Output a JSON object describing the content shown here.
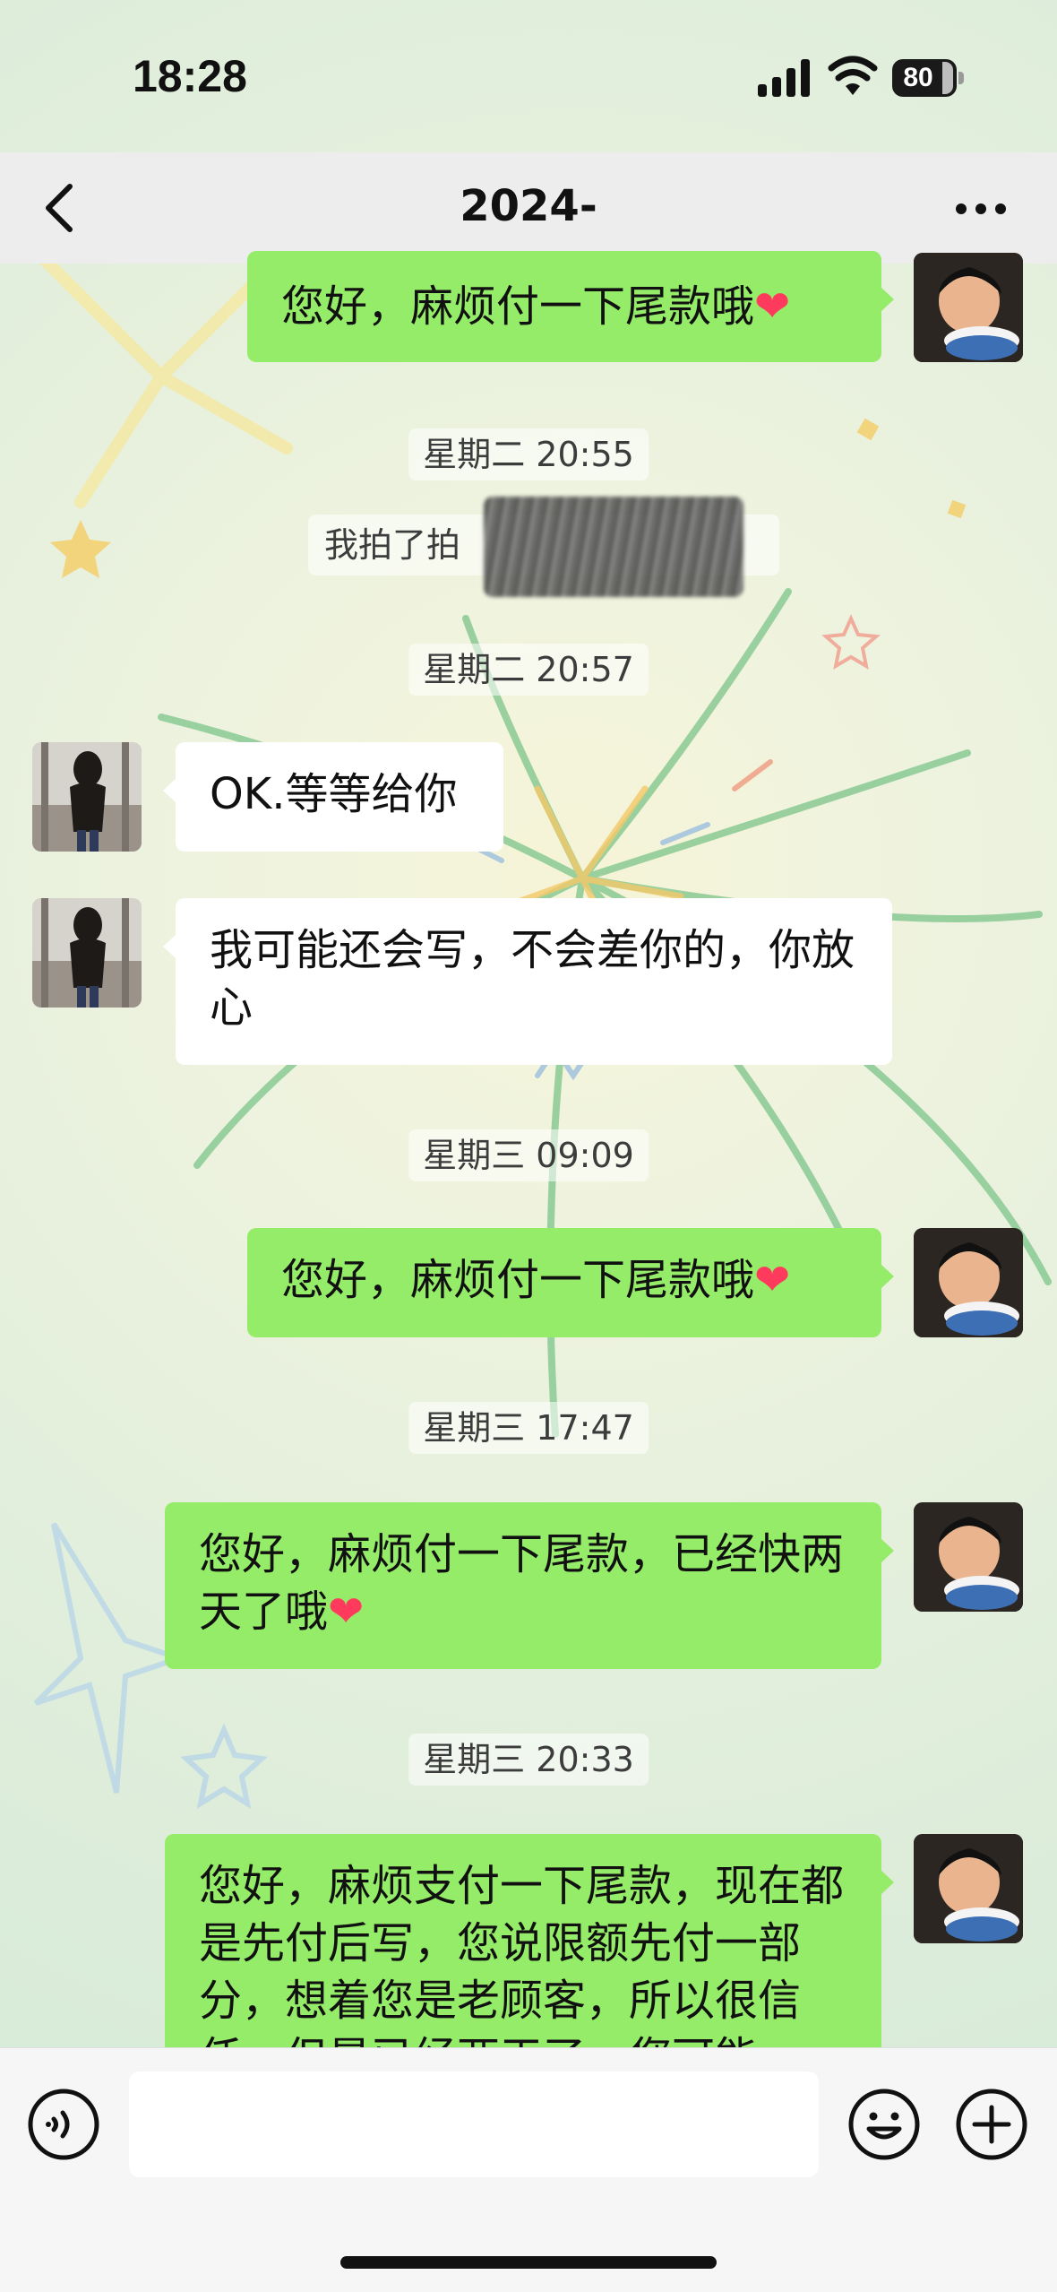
{
  "status_bar": {
    "time": "18:28",
    "battery": "80"
  },
  "header": {
    "title": "2024-"
  },
  "messages": {
    "m1": {
      "text": "您好，麻烦付一下尾款哦",
      "emoji": "❤"
    },
    "t1": "星期二 20:55",
    "sys1": "我拍了拍",
    "t2": "星期二 20:57",
    "m2": {
      "text": "OK.等等给你"
    },
    "m3": {
      "text": "我可能还会写，不会差你的，你放心"
    },
    "t3": "星期三 09:09",
    "m4": {
      "text": "您好，麻烦付一下尾款哦",
      "emoji": "❤"
    },
    "t4": "星期三 17:47",
    "m5": {
      "text": "您好，麻烦付一下尾款，已经快两天了哦",
      "emoji": "❤"
    },
    "t5": "星期三 20:33",
    "m6": {
      "text": "您好，麻烦支付一下尾款，现在都是先付后写，您说限额先付一部分，想着您是老顾客，所以很信任，但是已经两天了，您可能"
    }
  },
  "input_bar": {
    "placeholder": ""
  },
  "icons": {
    "back": "chevron-left-icon",
    "more": "more-dots-icon",
    "voice": "voice-icon",
    "emoji": "emoji-icon",
    "plus": "plus-icon"
  },
  "colors": {
    "outgoing_bubble": "#95ec69",
    "incoming_bubble": "#ffffff",
    "heart": "#ff3a5c"
  }
}
